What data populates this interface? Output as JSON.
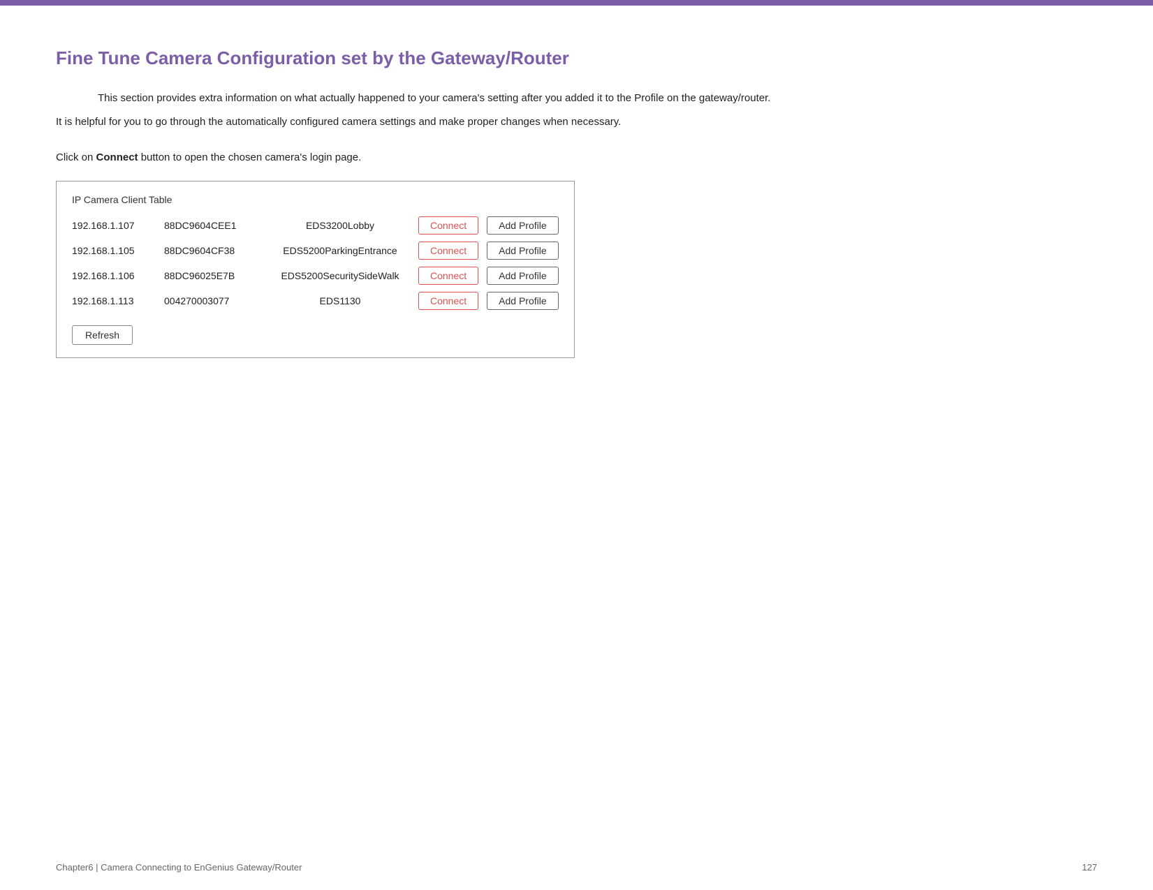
{
  "top_bar": {
    "color": "#7b5ea7"
  },
  "page_title": "Fine Tune Camera Configuration set by the Gateway/Router",
  "intro_paragraph1": "This section provides extra information on what actually happened to your camera's setting after you added it to the Profile on the gateway/router.",
  "intro_paragraph2": "It is helpful for you to go through the automatically configured camera settings and make proper changes when necessary.",
  "connect_instruction_prefix": "Click on ",
  "connect_instruction_bold": "Connect",
  "connect_instruction_suffix": " button to open the chosen camera's login page.",
  "table": {
    "title": "IP Camera Client Table",
    "rows": [
      {
        "ip": "192.168.1.107",
        "mac": "88DC9604CEE1",
        "name": "EDS3200Lobby",
        "connect_label": "Connect",
        "add_profile_label": "Add Profile",
        "connect_highlighted": true
      },
      {
        "ip": "192.168.1.105",
        "mac": "88DC9604CF38",
        "name": "EDS5200ParkingEntrance",
        "connect_label": "Connect",
        "add_profile_label": "Add Profile",
        "connect_highlighted": false
      },
      {
        "ip": "192.168.1.106",
        "mac": "88DC96025E7B",
        "name": "EDS5200SecuritySideWalk",
        "connect_label": "Connect",
        "add_profile_label": "Add Profile",
        "connect_highlighted": false
      },
      {
        "ip": "192.168.1.113",
        "mac": "004270003077",
        "name": "EDS1130",
        "connect_label": "Connect",
        "add_profile_label": "Add Profile",
        "connect_highlighted": false
      }
    ],
    "refresh_label": "Refresh"
  },
  "footer": {
    "left": "Chapter6  |  Camera Connecting to EnGenius Gateway/Router",
    "right": "127"
  }
}
